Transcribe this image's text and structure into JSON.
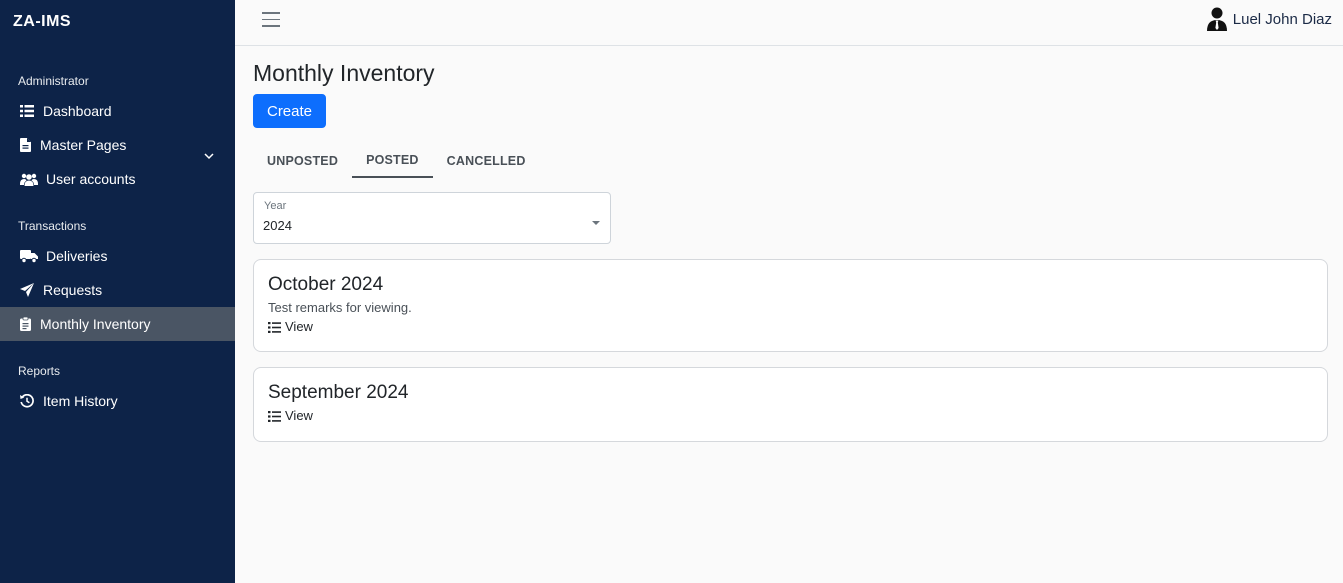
{
  "brand": "ZA-IMS",
  "sidebar": {
    "sections": [
      {
        "label": "Administrator"
      },
      {
        "label": "Transactions"
      },
      {
        "label": "Reports"
      }
    ],
    "items": [
      {
        "label": "Dashboard",
        "icon": "list-icon"
      },
      {
        "label": "Master Pages",
        "icon": "file-icon"
      },
      {
        "label": "User accounts",
        "icon": "users-icon"
      },
      {
        "label": "Deliveries",
        "icon": "truck-icon"
      },
      {
        "label": "Requests",
        "icon": "paper-plane-icon"
      },
      {
        "label": "Monthly Inventory",
        "icon": "clipboard-icon",
        "active": true
      },
      {
        "label": "Item History",
        "icon": "history-icon"
      }
    ]
  },
  "topbar": {
    "user_name": "Luel John Diaz"
  },
  "main": {
    "title": "Monthly Inventory",
    "create_label": "Create",
    "tabs": [
      {
        "label": "UNPOSTED"
      },
      {
        "label": "POSTED",
        "active": true
      },
      {
        "label": "CANCELLED"
      }
    ],
    "year_filter": {
      "label": "Year",
      "value": "2024"
    },
    "cards": [
      {
        "title": "October 2024",
        "remarks": "Test remarks for viewing.",
        "view_label": "View"
      },
      {
        "title": "September 2024",
        "view_label": "View"
      }
    ]
  },
  "colors": {
    "sidebar_bg": "#0d2348",
    "active_item_bg": "#4a5564",
    "primary": "#0d6efd"
  }
}
